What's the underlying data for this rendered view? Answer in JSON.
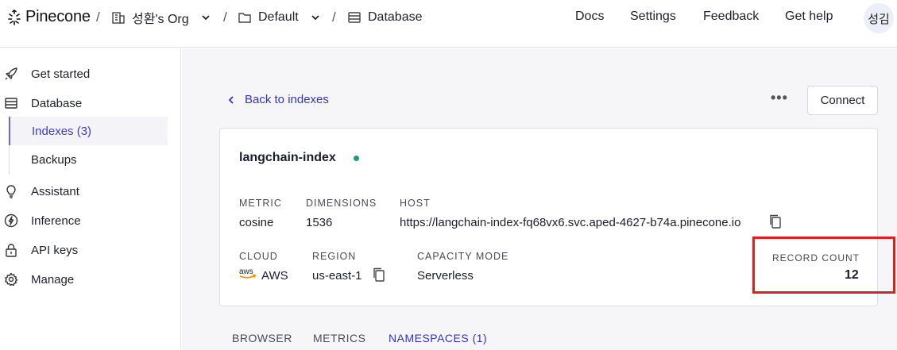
{
  "topbar": {
    "logo": "Pinecone",
    "breadcrumbs": [
      {
        "label": "성환's Org",
        "icon": "building-icon"
      },
      {
        "label": "Default",
        "icon": "folder-icon"
      },
      {
        "label": "Database",
        "icon": "database-icon"
      }
    ],
    "nav": [
      "Docs",
      "Settings",
      "Feedback",
      "Get help"
    ],
    "avatar": "성김"
  },
  "sidebar": {
    "items": [
      {
        "label": "Get started",
        "icon": "rocket-icon"
      },
      {
        "label": "Database",
        "icon": "database-icon"
      },
      {
        "label": "Indexes (3)",
        "sub": true,
        "active": true
      },
      {
        "label": "Backups",
        "sub": true
      },
      {
        "label": "Assistant",
        "icon": "lightbulb-icon"
      },
      {
        "label": "Inference",
        "icon": "bolt-icon"
      },
      {
        "label": "API keys",
        "icon": "lock-icon"
      },
      {
        "label": "Manage",
        "icon": "gear-icon"
      }
    ]
  },
  "main": {
    "back_label": "Back to indexes",
    "more_label": "•••",
    "connect_label": "Connect",
    "index": {
      "name": "langchain-index",
      "status_color": "#1f9d6e",
      "metric_label": "METRIC",
      "metric": "cosine",
      "dimensions_label": "DIMENSIONS",
      "dimensions": "1536",
      "host_label": "HOST",
      "host": "https://langchain-index-fq68vx6.svc.aped-4627-b74a.pinecone.io",
      "cloud_label": "CLOUD",
      "cloud": "AWS",
      "cloud_logo_text": "aws",
      "region_label": "REGION",
      "region": "us-east-1",
      "capacity_label": "CAPACITY MODE",
      "capacity": "Serverless",
      "record_count_label": "RECORD COUNT",
      "record_count": "12"
    },
    "tabs": [
      {
        "label": "BROWSER",
        "active": false
      },
      {
        "label": "METRICS",
        "active": false
      },
      {
        "label": "NAMESPACES (1)",
        "active": true
      }
    ]
  },
  "colors": {
    "accent": "#3432c0",
    "highlight": "#e02020",
    "status_ready": "#1f9d6e"
  }
}
